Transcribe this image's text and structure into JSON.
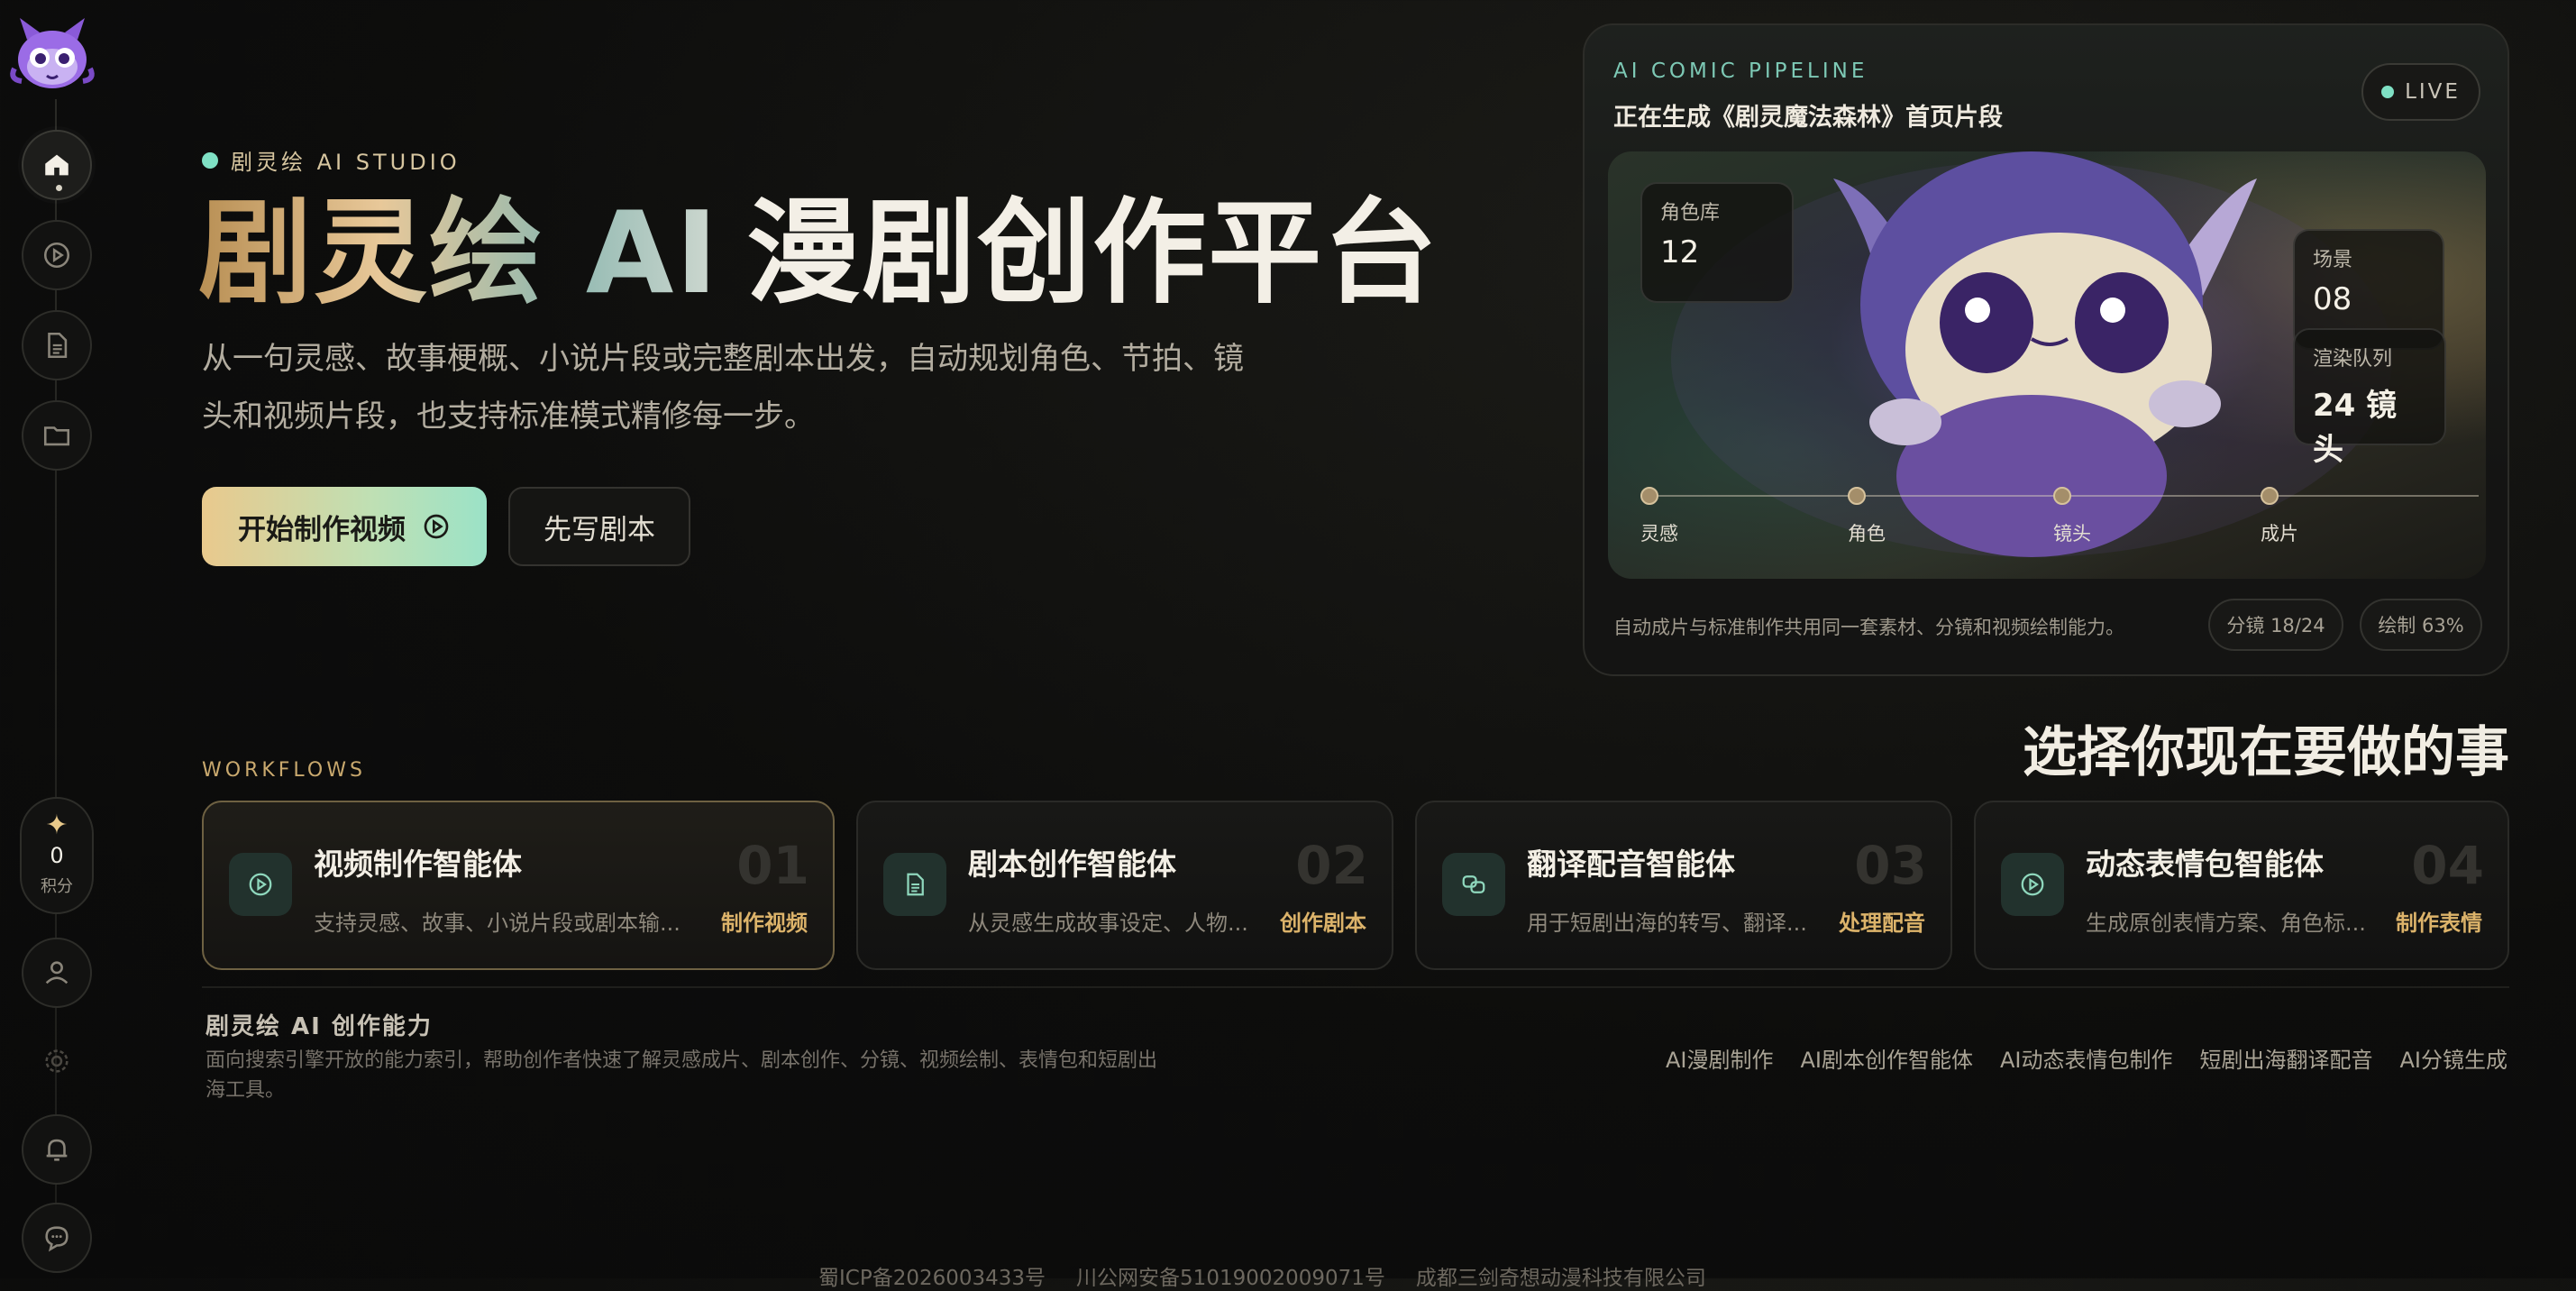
{
  "sidebar": {
    "logo": "mascot-logo",
    "nav": [
      {
        "name": "home",
        "icon": "home-icon"
      },
      {
        "name": "play",
        "icon": "play-circle-icon"
      },
      {
        "name": "documents",
        "icon": "document-icon"
      },
      {
        "name": "folder",
        "icon": "folder-icon"
      }
    ],
    "points": {
      "value": "0",
      "label": "积分"
    },
    "bottom": [
      {
        "name": "profile",
        "icon": "user-icon"
      },
      {
        "name": "settings",
        "icon": "gear-icon"
      },
      {
        "name": "notifications",
        "icon": "bell-icon"
      },
      {
        "name": "messages",
        "icon": "chat-icon"
      }
    ]
  },
  "hero": {
    "tag": "剧灵绘 AI STUDIO",
    "title_gradient": "剧灵绘 AI",
    "title_plain": "漫剧创作平台",
    "description": "从一句灵感、故事梗概、小说片段或完整剧本出发，自动规划角色、节拍、镜头和视频片段，也支持标准模式精修每一步。",
    "primary_button": "开始制作视频",
    "secondary_button": "先写剧本"
  },
  "pipeline": {
    "kicker": "AI COMIC PIPELINE",
    "title": "正在生成《剧灵魔法森林》首页片段",
    "live": "LIVE",
    "stats": {
      "characters": {
        "label": "角色库",
        "value": "12"
      },
      "scenes": {
        "label": "场景",
        "value": "08"
      },
      "render_queue": {
        "label": "渲染队列",
        "value": "24 镜头"
      }
    },
    "steps": [
      "灵感",
      "角色",
      "镜头",
      "成片"
    ],
    "footer": "自动成片与标准制作共用同一套素材、分镜和视频绘制能力。",
    "chips": [
      "分镜 18/24",
      "绘制 63%"
    ]
  },
  "workflows": {
    "kicker": "WORKFLOWS",
    "heading": "选择你现在要做的事",
    "cards": [
      {
        "title": "视频制作智能体",
        "num": "01",
        "desc": "支持灵感、故事、小说片段或剧本输...",
        "action": "制作视频",
        "icon": "play-circle-icon"
      },
      {
        "title": "剧本创作智能体",
        "num": "02",
        "desc": "从灵感生成故事设定、人物...",
        "action": "创作剧本",
        "icon": "document-icon"
      },
      {
        "title": "翻译配音智能体",
        "num": "03",
        "desc": "用于短剧出海的转写、翻译...",
        "action": "处理配音",
        "icon": "translate-icon"
      },
      {
        "title": "动态表情包智能体",
        "num": "04",
        "desc": "生成原创表情方案、角色标...",
        "action": "制作表情",
        "icon": "play-circle-icon"
      }
    ]
  },
  "capabilities": {
    "title": "剧灵绘 AI 创作能力",
    "description": "面向搜索引擎开放的能力索引，帮助创作者快速了解灵感成片、剧本创作、分镜、视频绘制、表情包和短剧出海工具。",
    "links": [
      "AI漫剧制作",
      "AI剧本创作智能体",
      "AI动态表情包制作",
      "短剧出海翻译配音",
      "AI分镜生成"
    ]
  },
  "footer": {
    "icp": "蜀ICP备2026003433号",
    "police": "川公网安备51019002009071号",
    "company": "成都三剑奇想动漫科技有限公司"
  }
}
